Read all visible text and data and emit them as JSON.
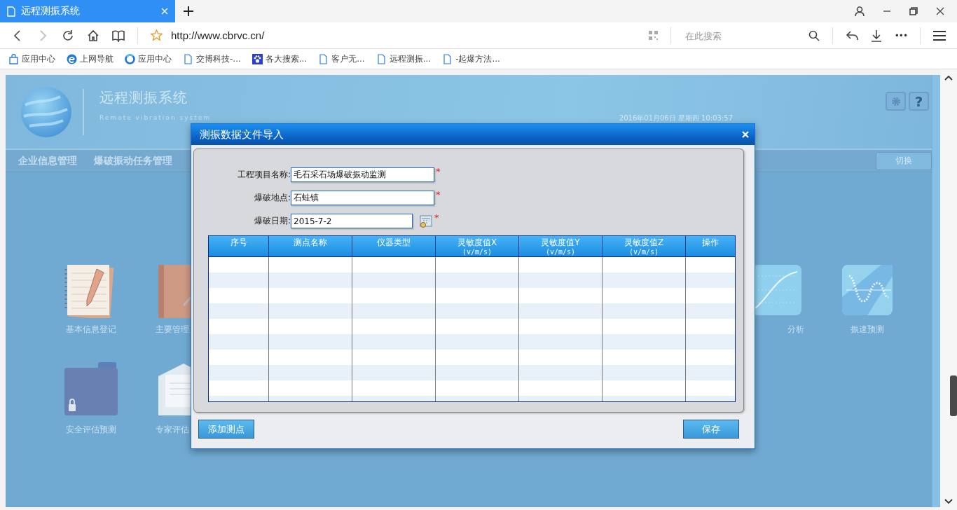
{
  "browser": {
    "tab": {
      "title": "远程测振系统",
      "selected": true
    },
    "address": "http://www.cbrvc.cn/",
    "search": {
      "placeholder": "在此搜索"
    },
    "more_label": "•••",
    "bookmarks": [
      {
        "kind": "bag",
        "label": "应用中心"
      },
      {
        "kind": "ie",
        "label": "上网导航"
      },
      {
        "kind": "ring",
        "label": "应用中心"
      },
      {
        "kind": "page",
        "label": "交博科技-..."
      },
      {
        "kind": "paw",
        "label": "各大搜索..."
      },
      {
        "kind": "page",
        "label": "客户无..."
      },
      {
        "kind": "page",
        "label": "远程测振..."
      },
      {
        "kind": "page",
        "label": "-起爆方法..."
      }
    ]
  },
  "app": {
    "title": "远程测振系统",
    "subtitle": "Remote vibration system",
    "datetime": "2016年01月06日 星期四 10:03:57",
    "help_label": "?",
    "nav": [
      {
        "label": "企业信息管理"
      },
      {
        "label": "爆破振动任务管理"
      }
    ],
    "switch_button": "切换",
    "desktop": [
      {
        "left": [
          {
            "kind": "notebook",
            "label": "基本信息登记"
          },
          {
            "kind": "folio",
            "label": "主要管理"
          }
        ],
        "right": [
          {
            "kind": "curve",
            "label": "分析"
          },
          {
            "kind": "wave",
            "label": "振速预测"
          }
        ]
      },
      {
        "left": [
          {
            "kind": "folder",
            "label": "安全评估预测"
          },
          {
            "kind": "envelope",
            "label": "专家评估"
          }
        ]
      }
    ]
  },
  "dialog": {
    "title": "测振数据文件导入",
    "fields": [
      {
        "kind": "text",
        "label": "工程项目名称:",
        "value": "毛石采石场爆破振动监测",
        "required_mark": "*"
      },
      {
        "kind": "text",
        "label": "爆破地点:",
        "value": "石蛙镇",
        "required_mark": "*"
      },
      {
        "kind": "date",
        "label": "爆破日期:",
        "value": "2015-7-2",
        "required_mark": "*"
      }
    ],
    "table": {
      "columns": [
        {
          "label": "序号"
        },
        {
          "label": "测点名称"
        },
        {
          "label": "仪器类型"
        },
        {
          "label": "灵敏度值X",
          "unit": "(v/m/s)"
        },
        {
          "label": "灵敏度值Y",
          "unit": "(v/m/s)"
        },
        {
          "label": "灵敏度值Z",
          "unit": "(v/m/s)"
        },
        {
          "label": "操作"
        }
      ]
    },
    "buttons": [
      {
        "label": "添加测点"
      },
      {
        "label": "保存"
      }
    ]
  }
}
